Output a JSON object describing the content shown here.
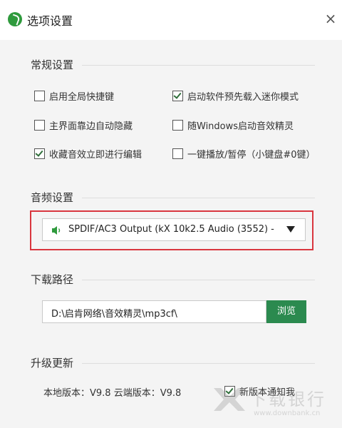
{
  "window": {
    "title": "选项设置",
    "close_glyph": "×"
  },
  "general": {
    "section_title": "常规设置",
    "options": [
      {
        "label": "启用全局快捷键",
        "checked": false
      },
      {
        "label": "启动软件预先载入迷你模式",
        "checked": true
      },
      {
        "label": "主界面靠边自动隐藏",
        "checked": false
      },
      {
        "label": "随Windows启动音效精灵",
        "checked": false
      },
      {
        "label": "收藏音效立即进行编辑",
        "checked": true
      },
      {
        "label": "一键播放/暂停（小键盘#0键）",
        "checked": false
      }
    ]
  },
  "audio": {
    "section_title": "音频设置",
    "device_icon": "speaker-icon",
    "selected_device": "SPDIF/AC3 Output (kX 10k2.5 Audio (3552) -"
  },
  "download": {
    "section_title": "下载路径",
    "path_value": "D:\\启肯网络\\音效精灵\\mp3cf\\",
    "browse_label": "浏览"
  },
  "upgrade": {
    "section_title": "升级更新",
    "version_info": "本地版本：V9.8  云端版本：V9.8",
    "notify_label": "新版本通知我",
    "notify_checked": true
  },
  "watermark": {
    "text": "下载银行",
    "url": "www.downbank.cn"
  },
  "colors": {
    "accent": "#2b8a4f",
    "highlight": "#d9363e",
    "logo": "#2f9a3d"
  }
}
